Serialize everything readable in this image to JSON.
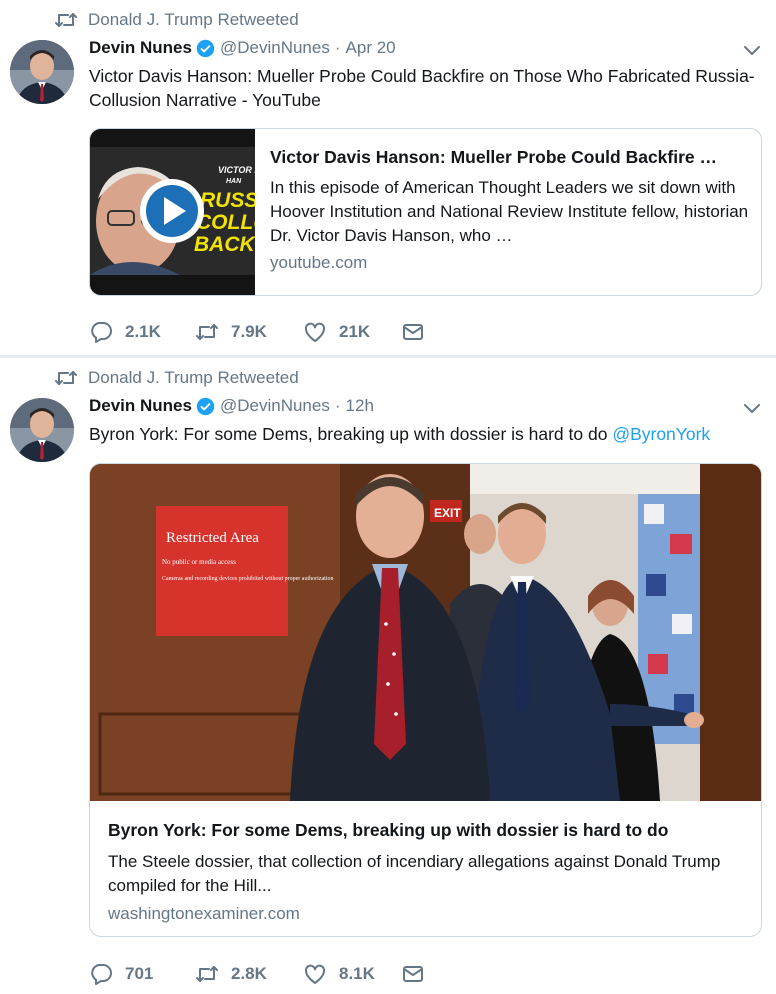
{
  "tweets": [
    {
      "retweeted_by": "Donald J. Trump Retweeted",
      "author_name": "Devin Nunes",
      "handle": "@DevinNunes",
      "separator": "·",
      "time": "Apr 20",
      "text": "Victor Davis Hanson: Mueller Probe Could Backfire on Those Who Fabricated Russia-Collusion Narrative - YouTube",
      "card": {
        "title": "Victor Davis Hanson: Mueller Probe Could Backfire …",
        "description": "In this episode of American Thought Leaders we sit down with Hoover Institution and National Review Institute fellow, historian Dr. Victor Davis Hanson, who …",
        "domain": "youtube.com",
        "thumb_texts": [
          "VICTOR D",
          "HAN",
          "RUSSIA",
          "COLLUSIO",
          "BACKFI"
        ]
      },
      "replies": "2.1K",
      "retweets": "7.9K",
      "likes": "21K"
    },
    {
      "retweeted_by": "Donald J. Trump Retweeted",
      "author_name": "Devin Nunes",
      "handle": "@DevinNunes",
      "separator": "·",
      "time": "12h",
      "text": "Byron York: For some Dems, breaking up with dossier is hard to do ",
      "mention": "@ByronYork",
      "card": {
        "title": "Byron York: For some Dems, breaking up with dossier is hard to do",
        "description": "The Steele dossier, that collection of incendiary allegations against Donald Trump compiled for the Hill...",
        "domain": "washingtonexaminer.com",
        "sign_title": "Restricted Area",
        "sign_line1": "No public or media access",
        "sign_line2": "Cameras and recording devices prohibited without proper authorization",
        "exit_sign": "EXIT"
      },
      "replies": "701",
      "retweets": "2.8K",
      "likes": "8.1K"
    }
  ],
  "colors": {
    "link_blue": "#1da1f2",
    "secondary_text": "#657786",
    "border": "#ccd6dd"
  },
  "icons": [
    "retweet-icon",
    "verified-icon",
    "caret-down-icon",
    "reply-icon",
    "like-icon",
    "dm-icon",
    "play-icon"
  ]
}
